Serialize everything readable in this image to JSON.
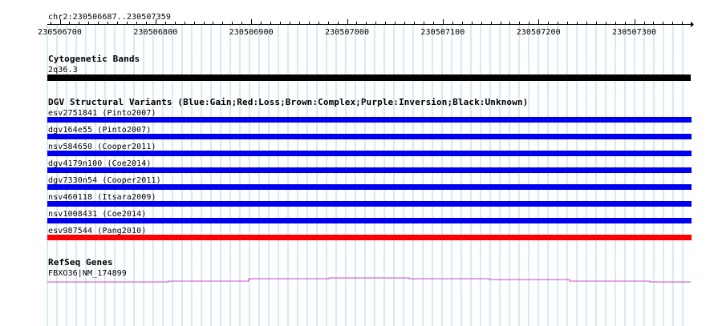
{
  "ruler": {
    "location": "chr2:230506687..230507359",
    "start": 230506687,
    "end": 230507359,
    "ticks": [
      "230506700",
      "230506800",
      "230506900",
      "230507000",
      "230507100",
      "230507200",
      "230507300"
    ]
  },
  "tracks": {
    "cytoband": {
      "title": "Cytogenetic Bands",
      "label": "2q36.3",
      "color": "#000000"
    },
    "dgv": {
      "title": "DGV Structural Variants (Blue:Gain;Red:Loss;Brown:Complex;Purple:Inversion;Black:Unknown)",
      "items": [
        {
          "label": "esv2751841 (Pinto2007)",
          "color": "#0000ee"
        },
        {
          "label": "dgv164e55 (Pinto2007)",
          "color": "#0000ee"
        },
        {
          "label": "nsv584650 (Cooper2011)",
          "color": "#0000ee"
        },
        {
          "label": "dgv4179n100 (Coe2014)",
          "color": "#0000ee"
        },
        {
          "label": "dgv7330n54 (Cooper2011)",
          "color": "#0000ee"
        },
        {
          "label": "nsv460118 (Itsara2009)",
          "color": "#0000ee"
        },
        {
          "label": "nsv1008431 (Coe2014)",
          "color": "#0000ee"
        },
        {
          "label": "esv987544 (Pang2010)",
          "color": "#ff0000"
        }
      ]
    },
    "refseq": {
      "title": "RefSeq Genes",
      "label": "FBXO36|NM_174899",
      "color": "#cc44cc"
    }
  },
  "colors": {
    "grid": "#a8d8e8",
    "axis": "#000000"
  }
}
